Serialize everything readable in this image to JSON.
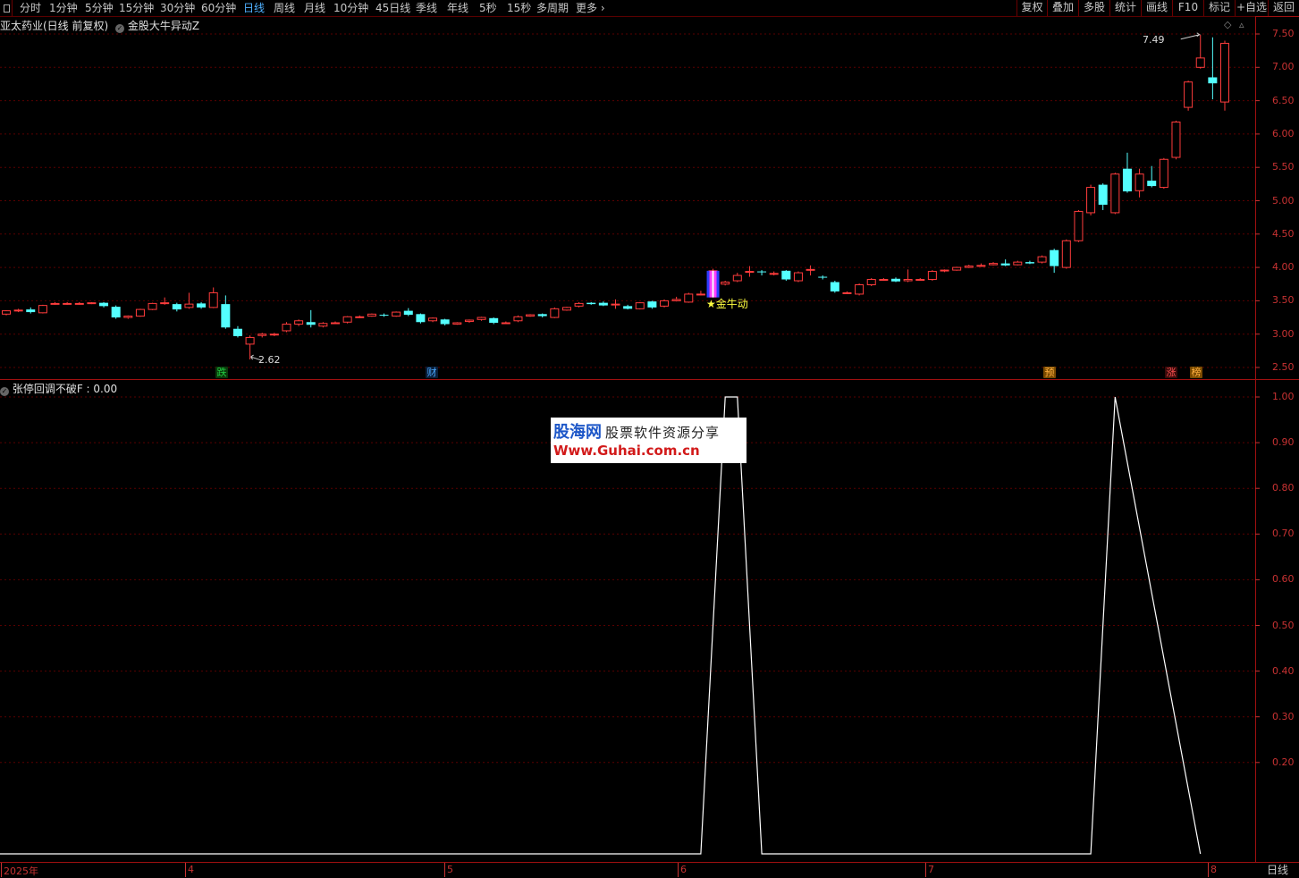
{
  "toolbar": {
    "periods": [
      "分时",
      "1分钟",
      "5分钟",
      "15分钟",
      "30分钟",
      "60分钟",
      "日线",
      "周线",
      "月线",
      "10分钟",
      "45日线",
      "季线",
      "年线",
      "5秒",
      "15秒",
      "多周期",
      "更多"
    ],
    "active_period": "日线",
    "right_buttons": [
      "复权",
      "叠加",
      "多股",
      "统计",
      "画线",
      "F10",
      "标记",
      "+自选",
      "返回"
    ]
  },
  "main_chart": {
    "header_title": "亚太药业(日线 前复权)",
    "indicator_name": "金股大牛异动Z",
    "y_ticks": [
      "7.50",
      "7.00",
      "6.50",
      "6.00",
      "5.50",
      "5.00",
      "4.50",
      "4.00",
      "3.50",
      "3.00",
      "2.50"
    ],
    "low_label": "2.62",
    "high_label": "7.49",
    "signal_label": "★金牛动",
    "tags": [
      {
        "text": "跌",
        "color": "#22cc44",
        "bg": "#0a3a0a"
      },
      {
        "text": "财",
        "color": "#4aa8ff",
        "bg": "#0a1f3a"
      },
      {
        "text": "预",
        "color": "#ffb040",
        "bg": "#7a4a00"
      },
      {
        "text": "涨",
        "color": "#ff5050",
        "bg": "#3a0a0a"
      },
      {
        "text": "榜",
        "color": "#ffb040",
        "bg": "#7a4a00"
      }
    ]
  },
  "sub_chart": {
    "header_label": "张停回调不破F : 0.00",
    "y_ticks": [
      "1.00",
      "0.90",
      "0.80",
      "0.70",
      "0.60",
      "0.50",
      "0.40",
      "0.30",
      "0.20"
    ]
  },
  "x_axis": {
    "labels": [
      "2025年",
      "4",
      "5",
      "6",
      "7",
      "8"
    ],
    "period": "日线"
  },
  "watermark": {
    "brand": "股海网",
    "subtitle": "股票软件资源分享",
    "url": "Www.Guhai.com.cn"
  },
  "colors": {
    "up": "#ff3c3c",
    "down": "#54ffff",
    "axis": "#c83232",
    "grid": "#5a0000",
    "signal": "#ffff40"
  },
  "chart_data": [
    {
      "type": "candlestick",
      "title": "亚太药业(日线 前复权)",
      "ylim": [
        2.4,
        7.7
      ],
      "y_ticks": [
        2.5,
        3.0,
        3.5,
        4.0,
        4.5,
        5.0,
        5.5,
        6.0,
        6.5,
        7.0,
        7.5
      ],
      "x_labels": [
        "2025年",
        "4",
        "5",
        "6",
        "7",
        "8"
      ],
      "candles": [
        [
          3.3,
          3.35,
          3.28,
          3.36
        ],
        [
          3.35,
          3.36,
          3.33,
          3.38
        ],
        [
          3.37,
          3.33,
          3.31,
          3.4
        ],
        [
          3.32,
          3.43,
          3.31,
          3.44
        ],
        [
          3.46,
          3.46,
          3.44,
          3.48
        ],
        [
          3.46,
          3.46,
          3.44,
          3.48
        ],
        [
          3.46,
          3.46,
          3.44,
          3.48
        ],
        [
          3.46,
          3.47,
          3.45,
          3.48
        ],
        [
          3.47,
          3.42,
          3.4,
          3.48
        ],
        [
          3.41,
          3.25,
          3.23,
          3.43
        ],
        [
          3.25,
          3.27,
          3.23,
          3.28
        ],
        [
          3.27,
          3.37,
          3.26,
          3.38
        ],
        [
          3.37,
          3.46,
          3.36,
          3.47
        ],
        [
          3.47,
          3.47,
          3.44,
          3.55
        ],
        [
          3.45,
          3.37,
          3.34,
          3.47
        ],
        [
          3.4,
          3.45,
          3.38,
          3.62
        ],
        [
          3.46,
          3.4,
          3.38,
          3.48
        ],
        [
          3.4,
          3.62,
          3.39,
          3.7
        ],
        [
          3.45,
          3.1,
          3.08,
          3.58
        ],
        [
          3.08,
          2.97,
          2.95,
          3.12
        ],
        [
          2.85,
          2.95,
          2.62,
          2.98
        ],
        [
          2.98,
          3.0,
          2.95,
          3.02
        ],
        [
          2.99,
          3.0,
          2.97,
          3.02
        ],
        [
          3.05,
          3.15,
          3.03,
          3.18
        ],
        [
          3.15,
          3.2,
          3.12,
          3.22
        ],
        [
          3.18,
          3.14,
          3.1,
          3.36
        ],
        [
          3.12,
          3.16,
          3.1,
          3.18
        ],
        [
          3.16,
          3.17,
          3.15,
          3.19
        ],
        [
          3.18,
          3.26,
          3.16,
          3.27
        ],
        [
          3.26,
          3.26,
          3.24,
          3.28
        ],
        [
          3.27,
          3.3,
          3.26,
          3.31
        ],
        [
          3.29,
          3.28,
          3.26,
          3.31
        ],
        [
          3.27,
          3.33,
          3.26,
          3.34
        ],
        [
          3.35,
          3.29,
          3.27,
          3.39
        ],
        [
          3.3,
          3.18,
          3.16,
          3.31
        ],
        [
          3.2,
          3.24,
          3.18,
          3.25
        ],
        [
          3.22,
          3.15,
          3.13,
          3.23
        ],
        [
          3.15,
          3.17,
          3.14,
          3.18
        ],
        [
          3.19,
          3.21,
          3.17,
          3.22
        ],
        [
          3.22,
          3.25,
          3.2,
          3.26
        ],
        [
          3.24,
          3.17,
          3.15,
          3.25
        ],
        [
          3.17,
          3.17,
          3.15,
          3.19
        ],
        [
          3.2,
          3.26,
          3.18,
          3.28
        ],
        [
          3.27,
          3.29,
          3.26,
          3.3
        ],
        [
          3.3,
          3.27,
          3.25,
          3.31
        ],
        [
          3.25,
          3.38,
          3.24,
          3.4
        ],
        [
          3.36,
          3.4,
          3.35,
          3.41
        ],
        [
          3.42,
          3.46,
          3.4,
          3.48
        ],
        [
          3.47,
          3.45,
          3.44,
          3.48
        ],
        [
          3.47,
          3.43,
          3.42,
          3.49
        ],
        [
          3.45,
          3.45,
          3.38,
          3.52
        ],
        [
          3.42,
          3.38,
          3.37,
          3.44
        ],
        [
          3.38,
          3.47,
          3.37,
          3.48
        ],
        [
          3.49,
          3.4,
          3.38,
          3.5
        ],
        [
          3.42,
          3.5,
          3.4,
          3.52
        ],
        [
          3.5,
          3.52,
          3.49,
          3.56
        ],
        [
          3.48,
          3.6,
          3.47,
          3.62
        ],
        [
          3.6,
          3.6,
          3.58,
          3.65
        ],
        [
          3.6,
          3.95,
          3.55,
          3.98
        ],
        [
          3.75,
          3.78,
          3.73,
          3.8
        ],
        [
          3.8,
          3.88,
          3.78,
          3.92
        ],
        [
          3.94,
          3.94,
          3.86,
          4.02
        ],
        [
          3.94,
          3.93,
          3.88,
          3.96
        ],
        [
          3.9,
          3.91,
          3.88,
          3.94
        ],
        [
          3.95,
          3.82,
          3.8,
          3.96
        ],
        [
          3.8,
          3.92,
          3.78,
          3.94
        ],
        [
          3.97,
          3.97,
          3.88,
          4.03
        ],
        [
          3.86,
          3.85,
          3.82,
          3.88
        ],
        [
          3.78,
          3.64,
          3.62,
          3.8
        ],
        [
          3.62,
          3.62,
          3.6,
          3.64
        ],
        [
          3.6,
          3.74,
          3.58,
          3.76
        ],
        [
          3.74,
          3.82,
          3.72,
          3.84
        ],
        [
          3.82,
          3.82,
          3.8,
          3.84
        ],
        [
          3.83,
          3.79,
          3.78,
          3.85
        ],
        [
          3.8,
          3.82,
          3.78,
          3.97
        ],
        [
          3.82,
          3.82,
          3.8,
          3.84
        ],
        [
          3.82,
          3.94,
          3.8,
          3.96
        ],
        [
          3.95,
          3.96,
          3.93,
          3.97
        ],
        [
          3.96,
          4.0,
          3.95,
          4.01
        ],
        [
          4.0,
          4.02,
          3.99,
          4.04
        ],
        [
          4.03,
          4.03,
          4.01,
          4.06
        ],
        [
          4.04,
          4.06,
          4.03,
          4.08
        ],
        [
          4.06,
          4.03,
          4.02,
          4.12
        ],
        [
          4.04,
          4.08,
          4.03,
          4.1
        ],
        [
          4.08,
          4.06,
          4.05,
          4.1
        ],
        [
          4.08,
          4.16,
          4.06,
          4.18
        ],
        [
          4.26,
          4.02,
          3.92,
          4.28
        ],
        [
          4.0,
          4.4,
          3.98,
          4.42
        ],
        [
          4.4,
          4.84,
          4.38,
          4.86
        ],
        [
          4.82,
          5.2,
          4.78,
          5.24
        ],
        [
          5.24,
          4.94,
          4.86,
          5.26
        ],
        [
          4.82,
          5.4,
          4.8,
          5.42
        ],
        [
          5.48,
          5.14,
          5.12,
          5.72
        ],
        [
          5.15,
          5.4,
          5.05,
          5.48
        ],
        [
          5.3,
          5.22,
          5.2,
          5.52
        ],
        [
          5.2,
          5.62,
          5.18,
          5.64
        ],
        [
          5.65,
          6.18,
          5.62,
          6.2
        ],
        [
          6.4,
          6.78,
          6.35,
          6.8
        ],
        [
          7.0,
          7.14,
          6.98,
          7.49
        ],
        [
          6.85,
          6.76,
          6.52,
          7.45
        ],
        [
          6.48,
          7.36,
          6.35,
          7.4
        ]
      ]
    },
    {
      "type": "line",
      "title": "张停回调不破F",
      "ylim": [
        0,
        1.0
      ],
      "y_ticks": [
        0.2,
        0.3,
        0.4,
        0.5,
        0.6,
        0.7,
        0.8,
        0.9,
        1.0
      ],
      "x": [
        0,
        57,
        59,
        60,
        62,
        89,
        91,
        98
      ],
      "values": [
        0,
        0,
        1,
        1,
        0,
        0,
        1,
        0
      ]
    }
  ]
}
